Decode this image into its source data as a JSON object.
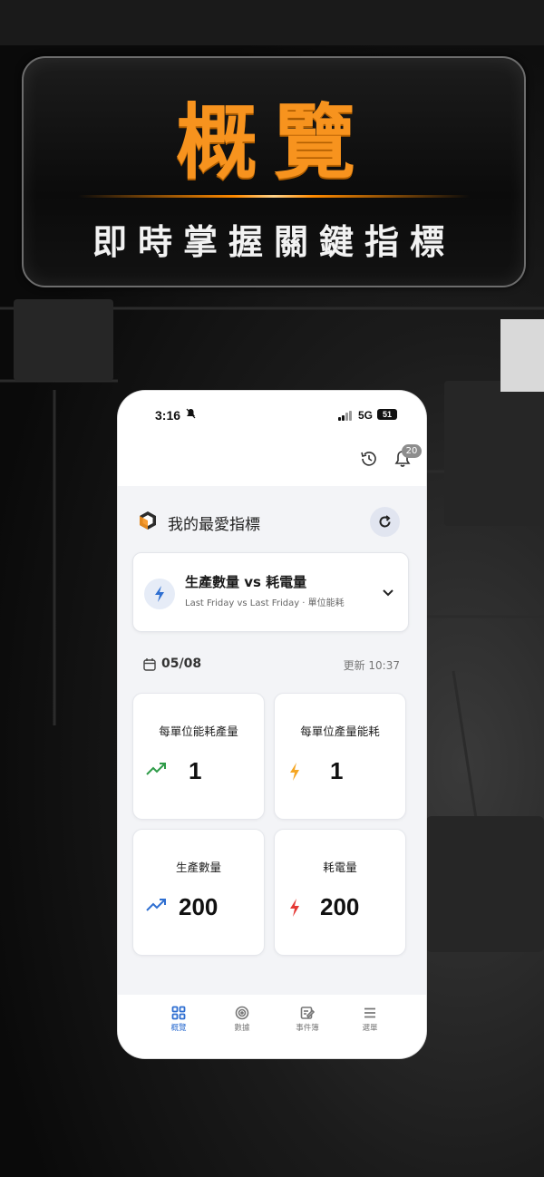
{
  "banner": {
    "title": "概覽",
    "subtitle": "即時掌握關鍵指標"
  },
  "status_bar": {
    "time": "3:16",
    "network": "5G",
    "battery": "51"
  },
  "header": {
    "notification_count": "20"
  },
  "favorites": {
    "title": "我的最愛指標",
    "metric_card": {
      "title": "生產數量 vs 耗電量",
      "subtitle": "Last Friday vs Last Friday · 單位能耗"
    }
  },
  "date_row": {
    "date": "05/08",
    "updated": "更新 10:37"
  },
  "tiles": [
    {
      "label": "每單位能耗產量",
      "value": "1",
      "icon": "trend-up-icon",
      "color": "#2e9b48"
    },
    {
      "label": "每單位產量能耗",
      "value": "1",
      "icon": "bolt-icon",
      "color": "#f5a623"
    },
    {
      "label": "生產數量",
      "value": "200",
      "icon": "trend-up-icon",
      "color": "#2f6fd1"
    },
    {
      "label": "耗電量",
      "value": "200",
      "icon": "bolt-icon",
      "color": "#e53935"
    }
  ],
  "tabbar": {
    "items": [
      {
        "label": "概覽",
        "icon": "grid-icon",
        "active": true
      },
      {
        "label": "數據",
        "icon": "target-icon",
        "active": false
      },
      {
        "label": "事件簿",
        "icon": "edit-icon",
        "active": false
      },
      {
        "label": "選單",
        "icon": "menu-icon",
        "active": false
      }
    ]
  },
  "colors": {
    "accent_orange": "#f7931e",
    "active_blue": "#2f6fd1"
  }
}
